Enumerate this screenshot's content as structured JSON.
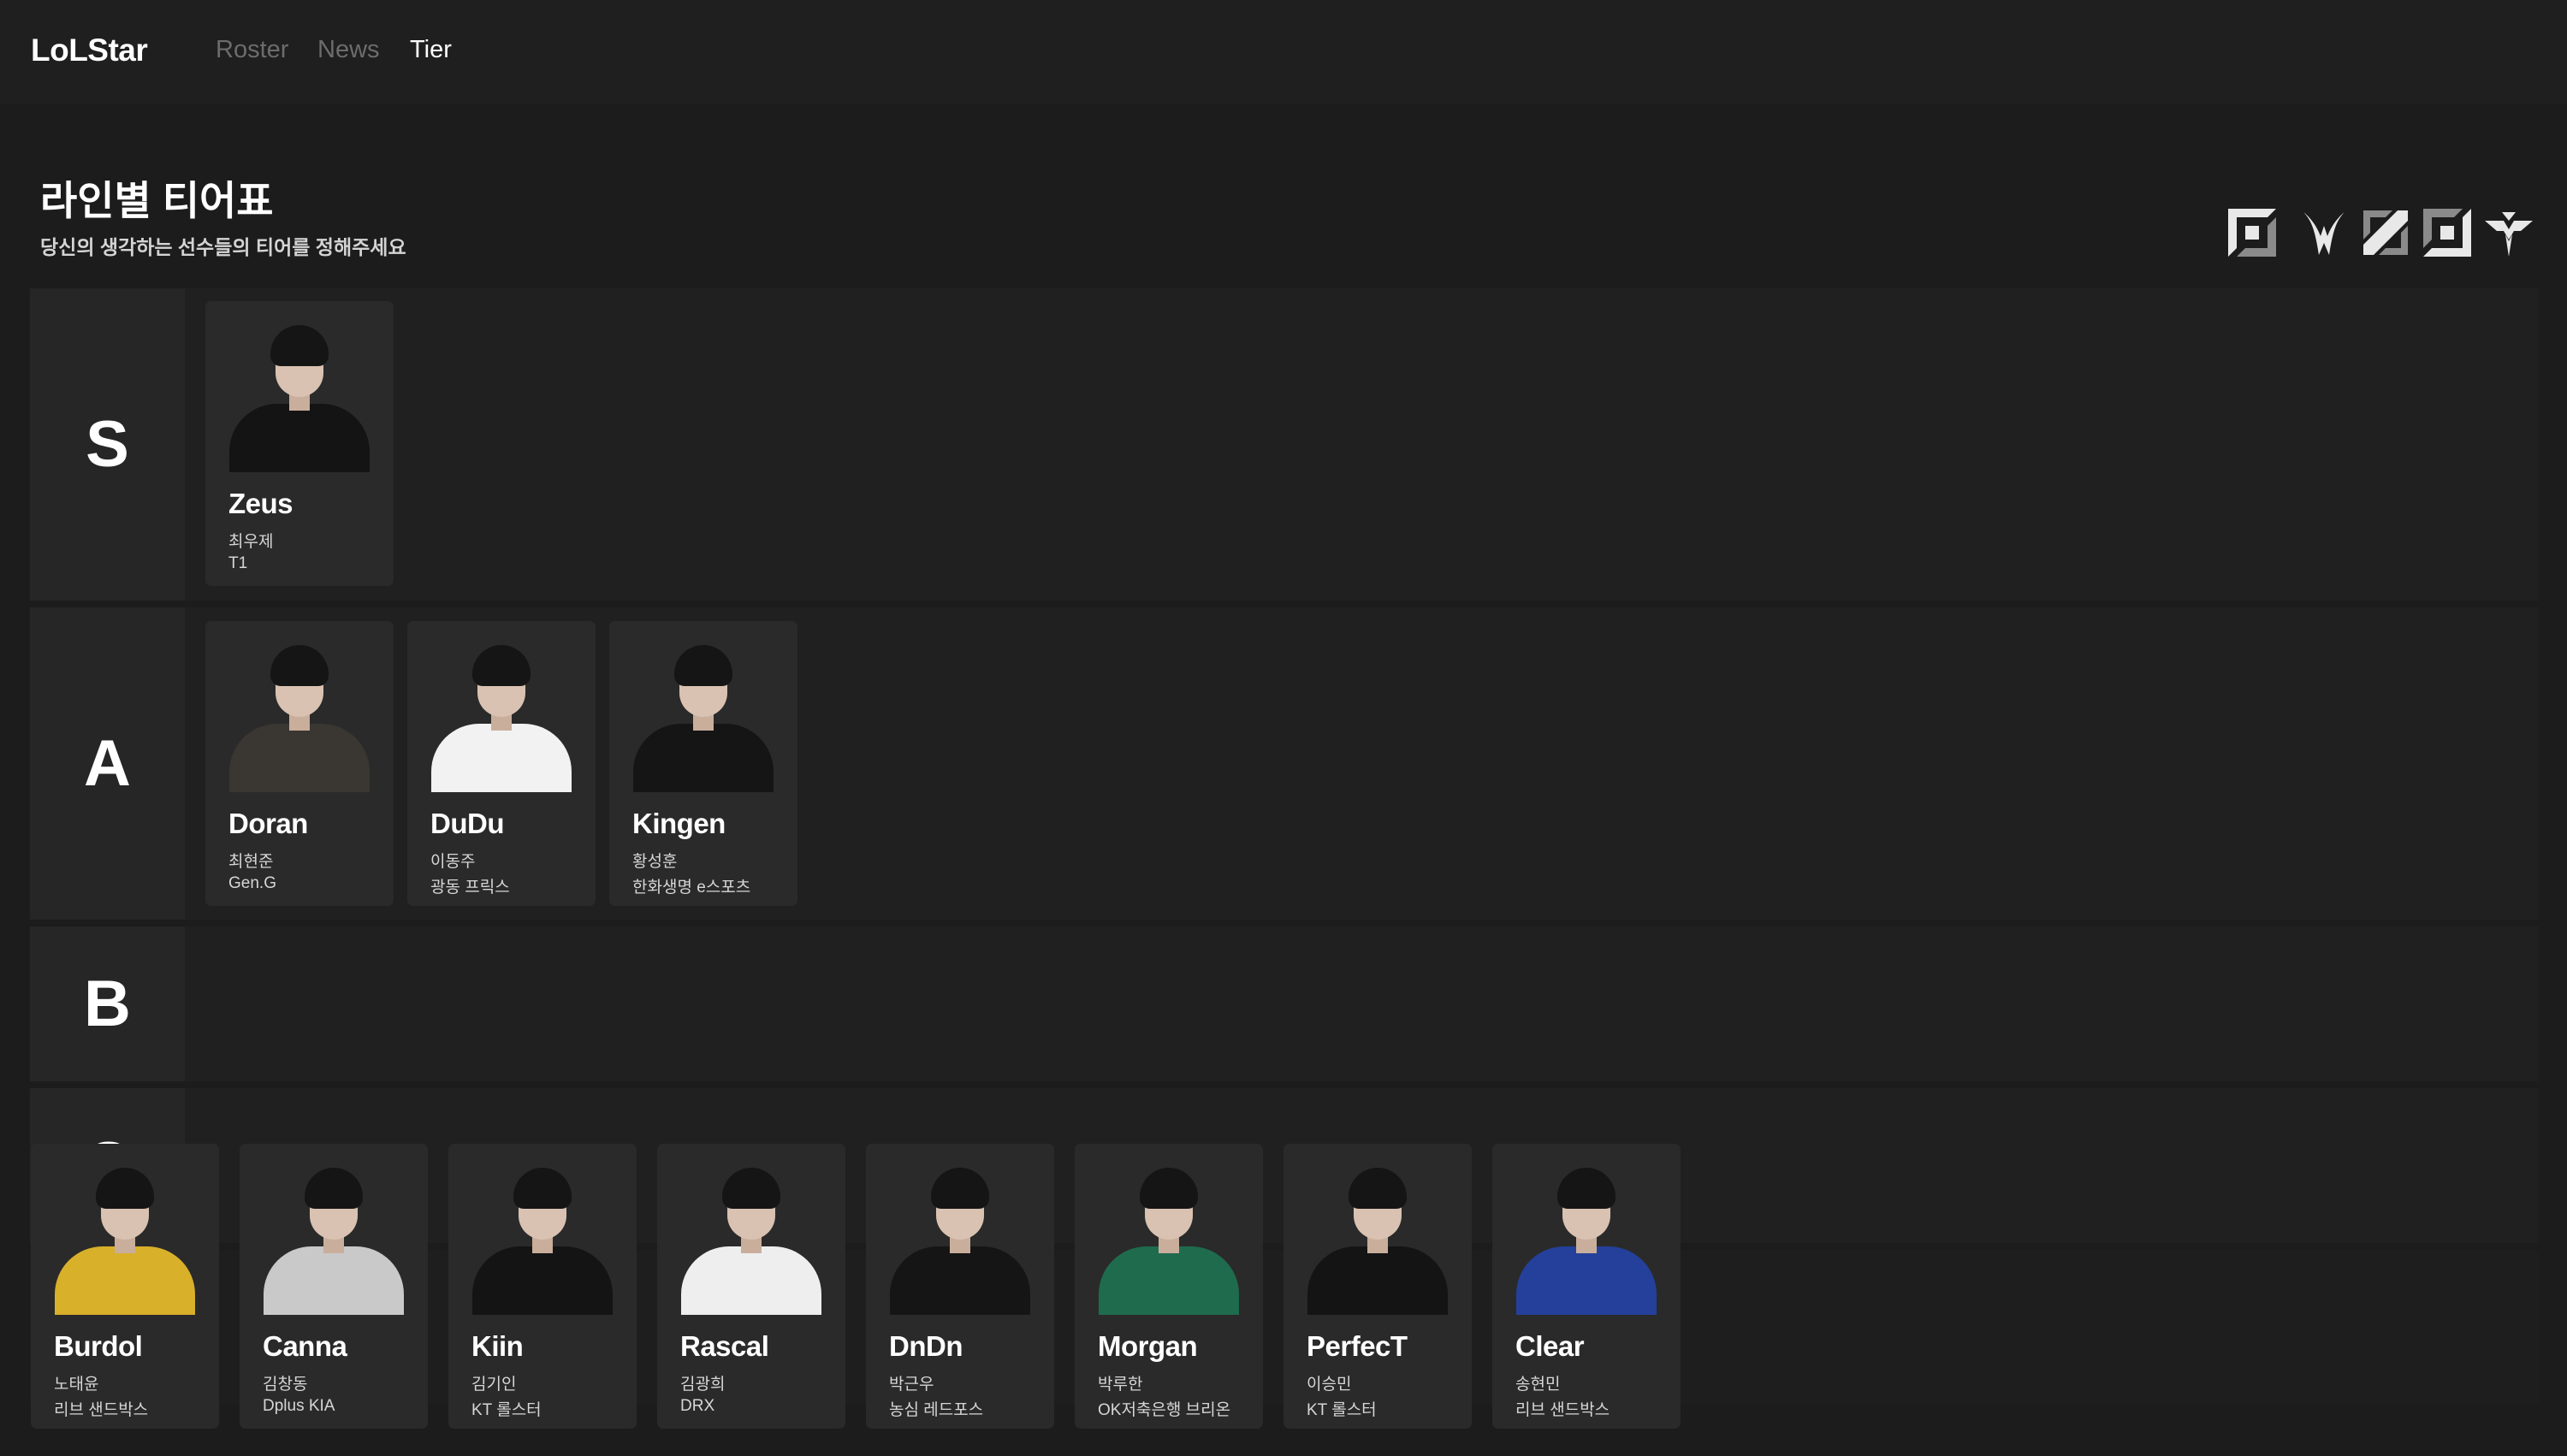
{
  "app": {
    "logo": "LoLStar",
    "nav": [
      {
        "label": "Roster",
        "active": false
      },
      {
        "label": "News",
        "active": false
      },
      {
        "label": "Tier",
        "active": true
      }
    ]
  },
  "page": {
    "title": "라인별 티어표",
    "subtitle": "당신의 생각하는 선수들의 티어를 정해주세요"
  },
  "lane_icons": [
    "top-lane-icon",
    "jungle-icon",
    "mid-lane-icon",
    "bot-lane-icon",
    "support-icon"
  ],
  "tiers": [
    {
      "label": "S",
      "players": [
        {
          "name": "Zeus",
          "real_name": "최우제",
          "team": "T1",
          "shirt": "#141414"
        }
      ]
    },
    {
      "label": "A",
      "players": [
        {
          "name": "Doran",
          "real_name": "최현준",
          "team": "Gen.G",
          "shirt": "#3a3632"
        },
        {
          "name": "DuDu",
          "real_name": "이동주",
          "team": "광동 프릭스",
          "shirt": "#f2f2f2"
        },
        {
          "name": "Kingen",
          "real_name": "황성훈",
          "team": "한화생명 e스포츠",
          "shirt": "#151515"
        }
      ]
    },
    {
      "label": "B",
      "players": []
    },
    {
      "label": "C",
      "players": []
    }
  ],
  "unranked": [
    {
      "name": "Burdol",
      "real_name": "노태윤",
      "team": "리브 샌드박스",
      "shirt": "#d8b02a"
    },
    {
      "name": "Canna",
      "real_name": "김창동",
      "team": "Dplus KIA",
      "shirt": "#c9c9c9"
    },
    {
      "name": "Kiin",
      "real_name": "김기인",
      "team": "KT 롤스터",
      "shirt": "#141414"
    },
    {
      "name": "Rascal",
      "real_name": "김광희",
      "team": "DRX",
      "shirt": "#eeeeee"
    },
    {
      "name": "DnDn",
      "real_name": "박근우",
      "team": "농심 레드포스",
      "shirt": "#151515"
    },
    {
      "name": "Morgan",
      "real_name": "박루한",
      "team": "OK저축은행 브리온",
      "shirt": "#1f6b4e"
    },
    {
      "name": "PerfecT",
      "real_name": "이승민",
      "team": "KT 롤스터",
      "shirt": "#141414"
    },
    {
      "name": "Clear",
      "real_name": "송현민",
      "team": "리브 샌드박스",
      "shirt": "#24409a"
    }
  ]
}
